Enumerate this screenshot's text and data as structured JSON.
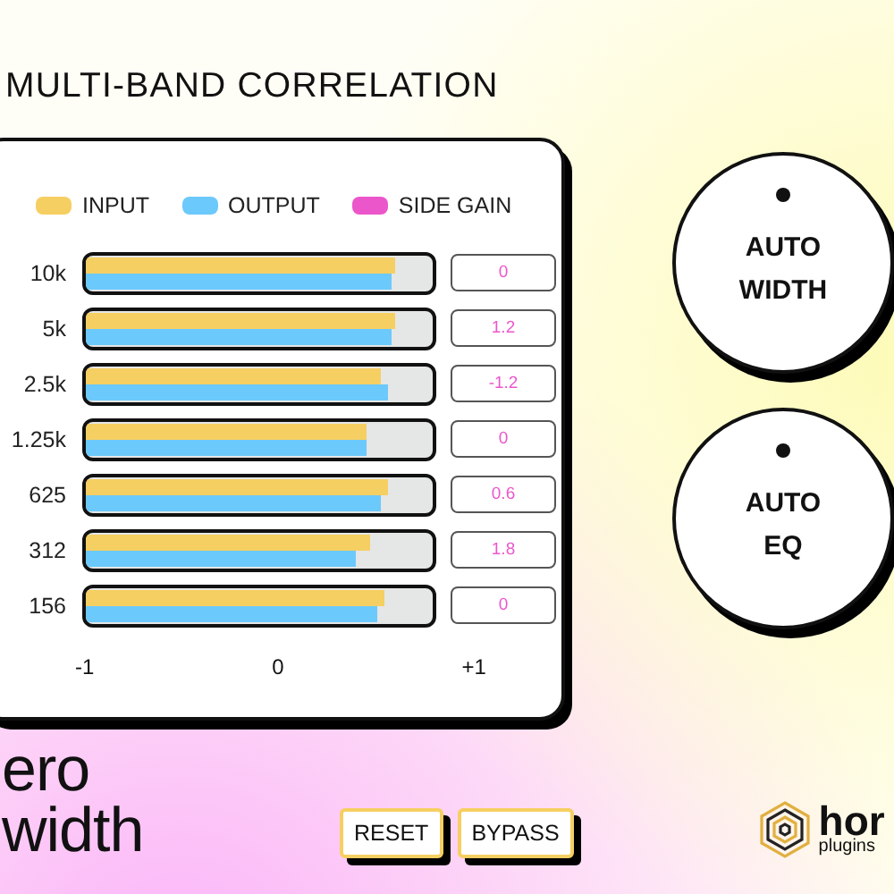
{
  "title": "MULTI-BAND CORRELATION",
  "legend": [
    {
      "label": "INPUT",
      "color": "#f6cf62"
    },
    {
      "label": "OUTPUT",
      "color": "#6cc9fb"
    },
    {
      "label": "SIDE GAIN",
      "color": "#ec56cb"
    }
  ],
  "bands": [
    {
      "label": "10k",
      "meters": [
        {
          "level": 0.89
        },
        {
          "level": 0.88
        }
      ],
      "side_gain": "0"
    },
    {
      "label": "5k",
      "meters": [
        {
          "level": 0.89
        },
        {
          "level": 0.88
        }
      ],
      "side_gain": "1.2"
    },
    {
      "label": "2.5k",
      "meters": [
        {
          "level": 0.85
        },
        {
          "level": 0.87
        }
      ],
      "side_gain": "-1.2"
    },
    {
      "label": "1.25k",
      "meters": [
        {
          "level": 0.81
        },
        {
          "level": 0.81
        }
      ],
      "side_gain": "0"
    },
    {
      "label": "625",
      "meters": [
        {
          "level": 0.87
        },
        {
          "level": 0.85
        }
      ],
      "side_gain": "0.6"
    },
    {
      "label": "312",
      "meters": [
        {
          "level": 0.82
        },
        {
          "level": 0.78
        }
      ],
      "side_gain": "1.8"
    },
    {
      "label": "156",
      "meters": [
        {
          "level": 0.86
        },
        {
          "level": 0.84
        }
      ],
      "side_gain": "0"
    }
  ],
  "axis": [
    "-1",
    "0",
    "+1"
  ],
  "knobs": [
    {
      "label": "AUTO WIDTH"
    },
    {
      "label": "AUTO EQ"
    }
  ],
  "brand": {
    "top": "ero",
    "bottom": "width"
  },
  "buttons": [
    "RESET",
    "BYPASS"
  ],
  "maker": {
    "name": "hor",
    "tagline": "plugins"
  }
}
